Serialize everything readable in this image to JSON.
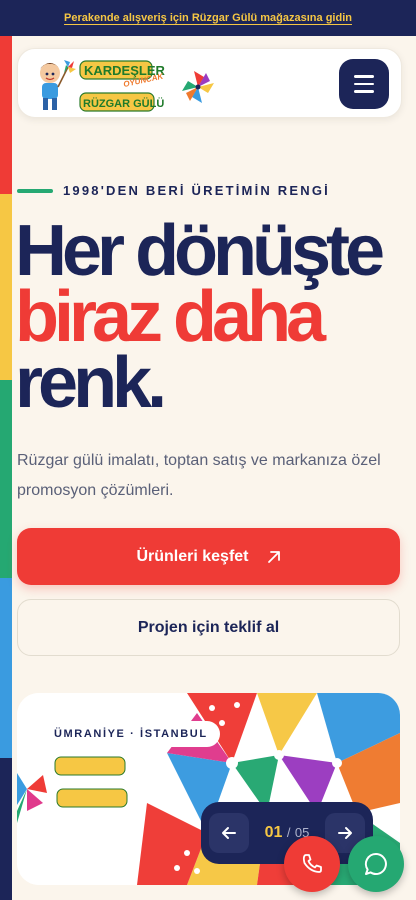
{
  "topbar": {
    "link_text": "Perakende alışveriş için Rüzgar Gülü mağazasına gidin"
  },
  "brand": {
    "line1": "KARDEŞLER",
    "line1_suffix": "OYUNCAK",
    "line2": "RÜZGAR GÜLÜ"
  },
  "hero": {
    "eyebrow": "1998'DEN BERİ ÜRETİMİN RENGİ",
    "headline_1": "Her dönüşte",
    "headline_2": "biraz daha",
    "headline_3": "renk.",
    "description": "Rüzgar gülü imalatı, toptan satış ve markanıza özel promosyon çözümleri.",
    "primary_cta": "Ürünleri keşfet",
    "secondary_cta": "Projen için teklif al"
  },
  "showcase": {
    "location": "ÜMRANİYE · İSTANBUL",
    "current": "01",
    "separator": "/",
    "total": "05"
  },
  "icons": {
    "menu": "hamburger-icon",
    "primary_cta": "arrow-up-right-icon",
    "prev": "arrow-left-icon",
    "next": "arrow-right-icon",
    "phone": "phone-icon",
    "chat": "chat-bubble-icon"
  },
  "colors": {
    "navy": "#1c2558",
    "red": "#ef3b36",
    "green": "#25a872",
    "yellow": "#f6c744",
    "blue": "#3a9be0",
    "cream": "#fbf5ec"
  }
}
